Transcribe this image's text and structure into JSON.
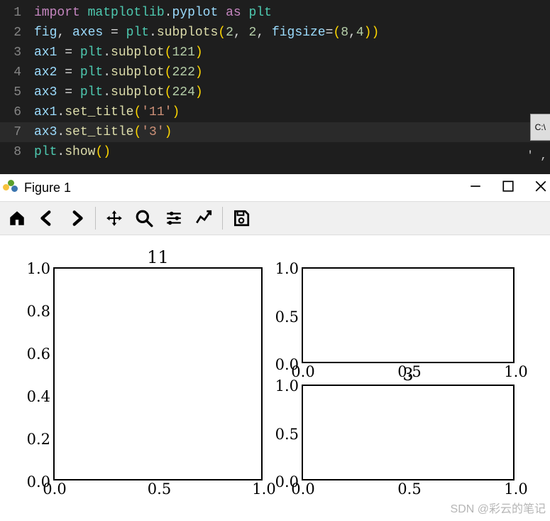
{
  "editor": {
    "lines": [
      {
        "n": "1",
        "tokens": [
          {
            "t": "import ",
            "c": "tok-kw"
          },
          {
            "t": "matplotlib",
            "c": "tok-mod"
          },
          {
            "t": ".",
            "c": "tok-op"
          },
          {
            "t": "pyplot",
            "c": "tok-id"
          },
          {
            "t": " as ",
            "c": "tok-kw"
          },
          {
            "t": "plt",
            "c": "tok-mod"
          }
        ]
      },
      {
        "n": "2",
        "tokens": [
          {
            "t": "fig",
            "c": "tok-id"
          },
          {
            "t": ", ",
            "c": "tok-op"
          },
          {
            "t": "axes",
            "c": "tok-id"
          },
          {
            "t": " = ",
            "c": "tok-op"
          },
          {
            "t": "plt",
            "c": "tok-mod"
          },
          {
            "t": ".",
            "c": "tok-op"
          },
          {
            "t": "subplots",
            "c": "tok-fn"
          },
          {
            "t": "(",
            "c": "tok-punc"
          },
          {
            "t": "2",
            "c": "tok-num"
          },
          {
            "t": ", ",
            "c": "tok-op"
          },
          {
            "t": "2",
            "c": "tok-num"
          },
          {
            "t": ", ",
            "c": "tok-op"
          },
          {
            "t": "figsize",
            "c": "tok-arg"
          },
          {
            "t": "=",
            "c": "tok-op"
          },
          {
            "t": "(",
            "c": "tok-punc"
          },
          {
            "t": "8",
            "c": "tok-num"
          },
          {
            "t": ",",
            "c": "tok-op"
          },
          {
            "t": "4",
            "c": "tok-num"
          },
          {
            "t": ")",
            "c": "tok-punc"
          },
          {
            "t": ")",
            "c": "tok-punc"
          }
        ]
      },
      {
        "n": "3",
        "tokens": [
          {
            "t": "ax1",
            "c": "tok-id"
          },
          {
            "t": " = ",
            "c": "tok-op"
          },
          {
            "t": "plt",
            "c": "tok-mod"
          },
          {
            "t": ".",
            "c": "tok-op"
          },
          {
            "t": "subplot",
            "c": "tok-fn"
          },
          {
            "t": "(",
            "c": "tok-punc"
          },
          {
            "t": "121",
            "c": "tok-num"
          },
          {
            "t": ")",
            "c": "tok-punc"
          }
        ]
      },
      {
        "n": "4",
        "tokens": [
          {
            "t": "ax2",
            "c": "tok-id"
          },
          {
            "t": " = ",
            "c": "tok-op"
          },
          {
            "t": "plt",
            "c": "tok-mod"
          },
          {
            "t": ".",
            "c": "tok-op"
          },
          {
            "t": "subplot",
            "c": "tok-fn"
          },
          {
            "t": "(",
            "c": "tok-punc"
          },
          {
            "t": "222",
            "c": "tok-num"
          },
          {
            "t": ")",
            "c": "tok-punc"
          }
        ]
      },
      {
        "n": "5",
        "tokens": [
          {
            "t": "ax3",
            "c": "tok-id"
          },
          {
            "t": " = ",
            "c": "tok-op"
          },
          {
            "t": "plt",
            "c": "tok-mod"
          },
          {
            "t": ".",
            "c": "tok-op"
          },
          {
            "t": "subplot",
            "c": "tok-fn"
          },
          {
            "t": "(",
            "c": "tok-punc"
          },
          {
            "t": "224",
            "c": "tok-num"
          },
          {
            "t": ")",
            "c": "tok-punc"
          }
        ]
      },
      {
        "n": "6",
        "tokens": [
          {
            "t": "ax1",
            "c": "tok-id"
          },
          {
            "t": ".",
            "c": "tok-op"
          },
          {
            "t": "set_title",
            "c": "tok-fn"
          },
          {
            "t": "(",
            "c": "tok-punc"
          },
          {
            "t": "'11'",
            "c": "tok-str"
          },
          {
            "t": ")",
            "c": "tok-punc"
          }
        ]
      },
      {
        "n": "7",
        "hl": true,
        "tokens": [
          {
            "t": "ax3",
            "c": "tok-id"
          },
          {
            "t": ".",
            "c": "tok-op"
          },
          {
            "t": "set_title",
            "c": "tok-fn"
          },
          {
            "t": "(",
            "c": "tok-punc"
          },
          {
            "t": "'3'",
            "c": "tok-str"
          },
          {
            "t": ")",
            "c": "tok-punc"
          }
        ]
      },
      {
        "n": "8",
        "tokens": [
          {
            "t": "plt",
            "c": "tok-mod"
          },
          {
            "t": ".",
            "c": "tok-op"
          },
          {
            "t": "show",
            "c": "tok-fn"
          },
          {
            "t": "(",
            "c": "tok-punc"
          },
          {
            "t": ")",
            "c": "tok-punc"
          }
        ]
      }
    ],
    "cmd_badge": "C:\\",
    "quote_badge": "' ,"
  },
  "figure": {
    "title": "Figure 1",
    "toolbar": {
      "home": "Home",
      "back": "Back",
      "forward": "Forward",
      "pan": "Pan",
      "zoom": "Zoom",
      "subplots": "Configure subplots",
      "axes_edit": "Edit axis",
      "save": "Save"
    }
  },
  "watermark": "SDN @彩云的笔记",
  "chart_data": [
    {
      "id": "ax1",
      "type": "line",
      "title": "11",
      "xlim": [
        0.0,
        1.0
      ],
      "ylim": [
        0.0,
        1.0
      ],
      "xticks": [
        0.0,
        0.5,
        1.0
      ],
      "yticks": [
        0.0,
        0.2,
        0.4,
        0.6,
        0.8,
        1.0
      ],
      "series": []
    },
    {
      "id": "ax2",
      "type": "line",
      "title": "",
      "xlim": [
        0.0,
        1.0
      ],
      "ylim": [
        0.0,
        1.0
      ],
      "xticks": [
        0.0,
        0.5,
        1.0
      ],
      "yticks": [
        0.0,
        0.5,
        1.0
      ],
      "series": []
    },
    {
      "id": "ax3",
      "type": "line",
      "title": "3",
      "xlim": [
        0.0,
        1.0
      ],
      "ylim": [
        0.0,
        1.0
      ],
      "xticks": [
        0.0,
        0.5,
        1.0
      ],
      "yticks": [
        0.0,
        0.5,
        1.0
      ],
      "series": []
    }
  ]
}
